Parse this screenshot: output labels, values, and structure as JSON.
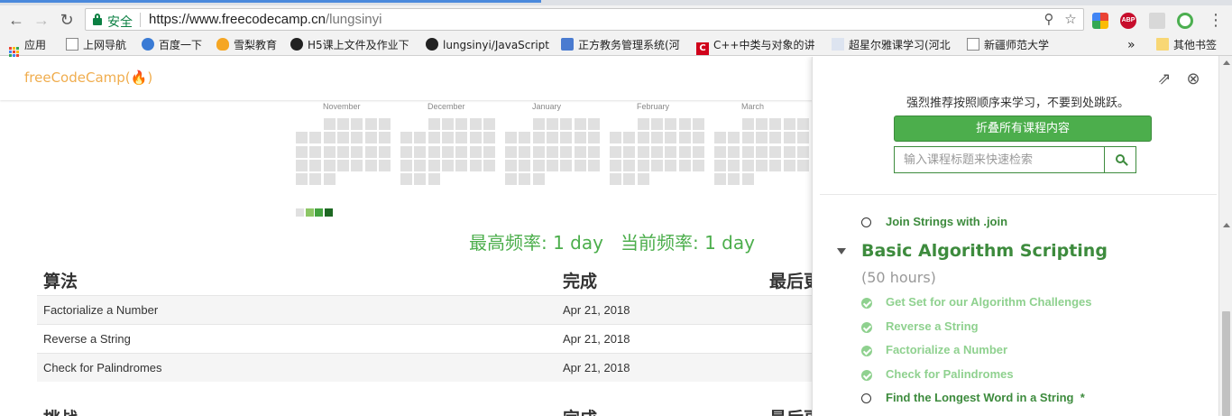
{
  "browser": {
    "secure_label": "安全",
    "url_host": "https://www.freecodecamp.cn",
    "url_path": "/lungsinyi",
    "bookmarks": [
      {
        "label": "应用"
      },
      {
        "label": "上网导航"
      },
      {
        "label": "百度一下"
      },
      {
        "label": "雪梨教育"
      },
      {
        "label": "H5课上文件及作业下"
      },
      {
        "label": "lungsinyi/JavaScript"
      },
      {
        "label": "正方教务管理系统(河"
      },
      {
        "label": "C++中类与对象的讲"
      },
      {
        "label": "超星尔雅课学习(河北"
      },
      {
        "label": "新疆师范大学"
      },
      {
        "label": "»"
      },
      {
        "label": "其他书签"
      }
    ],
    "extension_icons": [
      "google-photos",
      "adblock-plus",
      "camera",
      "chrome-sync"
    ]
  },
  "site": {
    "logo_text": "freeCodeCamp(",
    "logo_flame": "🔥",
    "logo_close": ")"
  },
  "heatmap": {
    "months": [
      "November",
      "December",
      "January",
      "February",
      "March"
    ],
    "legend_colors": [
      "#d6e685",
      "#8cc665",
      "#44a340",
      "#1e6823"
    ]
  },
  "frequency": {
    "max_label": "最高频率: 1 day",
    "current_label": "当前频率: 1 day"
  },
  "algorithms_table": {
    "headers": [
      "算法",
      "完成",
      "最后更"
    ],
    "rows": [
      {
        "name": "Factorialize a Number",
        "completed": "Apr 21, 2018"
      },
      {
        "name": "Reverse a String",
        "completed": "Apr 21, 2018"
      },
      {
        "name": "Check for Palindromes",
        "completed": "Apr 21, 2018"
      }
    ]
  },
  "challenges_table": {
    "headers": [
      "挑战",
      "完成",
      "最后更"
    ]
  },
  "map_panel": {
    "hint": "强烈推荐按照顺序来学习，不要到处跳跃。",
    "collapse_label": "折叠所有课程内容",
    "search_placeholder": "输入课程标题来快速检索",
    "prev_item": {
      "label": "Join Strings with .join",
      "done": false
    },
    "block_title": "Basic Algorithm Scripting",
    "block_hours": "(50 hours)",
    "challenges": [
      {
        "label": "Get Set for our Algorithm Challenges",
        "done": true
      },
      {
        "label": "Reverse a String",
        "done": true
      },
      {
        "label": "Factorialize a Number",
        "done": true
      },
      {
        "label": "Check for Palindromes",
        "done": true
      },
      {
        "label": "Find the Longest Word in a String",
        "done": false,
        "star": "*"
      }
    ]
  }
}
